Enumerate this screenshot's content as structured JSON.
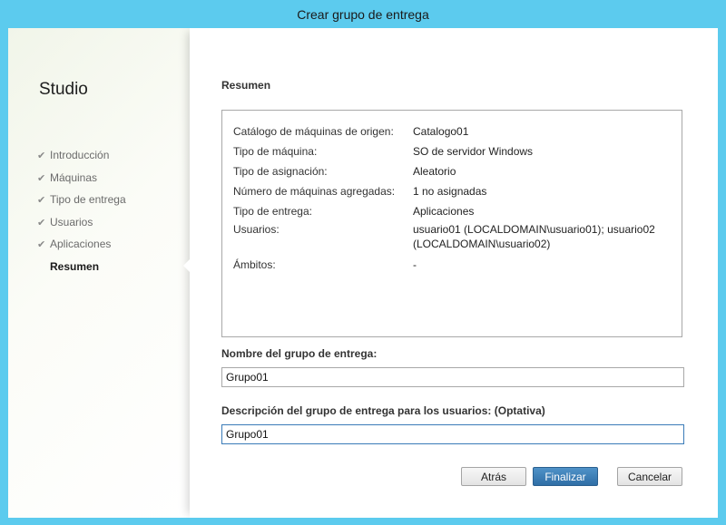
{
  "window": {
    "title": "Crear grupo de entrega"
  },
  "sidebar": {
    "app_title": "Studio",
    "steps": [
      {
        "label": "Introducción",
        "done": true
      },
      {
        "label": "Máquinas",
        "done": true
      },
      {
        "label": "Tipo de entrega",
        "done": true
      },
      {
        "label": "Usuarios",
        "done": true
      },
      {
        "label": "Aplicaciones",
        "done": true
      },
      {
        "label": "Resumen",
        "done": false
      }
    ],
    "check_glyph": "✔"
  },
  "main": {
    "section_title": "Resumen",
    "summary": [
      {
        "key": "Catálogo de máquinas de origen:",
        "value": "Catalogo01"
      },
      {
        "key": "Tipo de máquina:",
        "value": "SO de servidor Windows"
      },
      {
        "key": "Tipo de asignación:",
        "value": "Aleatorio"
      },
      {
        "key": "Número de máquinas agregadas:",
        "value": "1 no asignadas"
      },
      {
        "key": "Tipo de entrega:",
        "value": "Aplicaciones"
      },
      {
        "key": "Usuarios:",
        "value": "usuario01 (LOCALDOMAIN\\usuario01); usuario02 (LOCALDOMAIN\\usuario02)"
      },
      {
        "key": "Ámbitos:",
        "value": "-"
      }
    ],
    "name_label": "Nombre del grupo de entrega:",
    "name_value": "Grupo01",
    "desc_label": "Descripción del grupo de entrega para los usuarios: (Optativa)",
    "desc_value": "Grupo01"
  },
  "buttons": {
    "back": "Atrás",
    "finish": "Finalizar",
    "cancel": "Cancelar"
  },
  "colors": {
    "frame": "#5ccbee",
    "primary_button": "#2f6ea6",
    "focus_border": "#3a7bb8"
  }
}
